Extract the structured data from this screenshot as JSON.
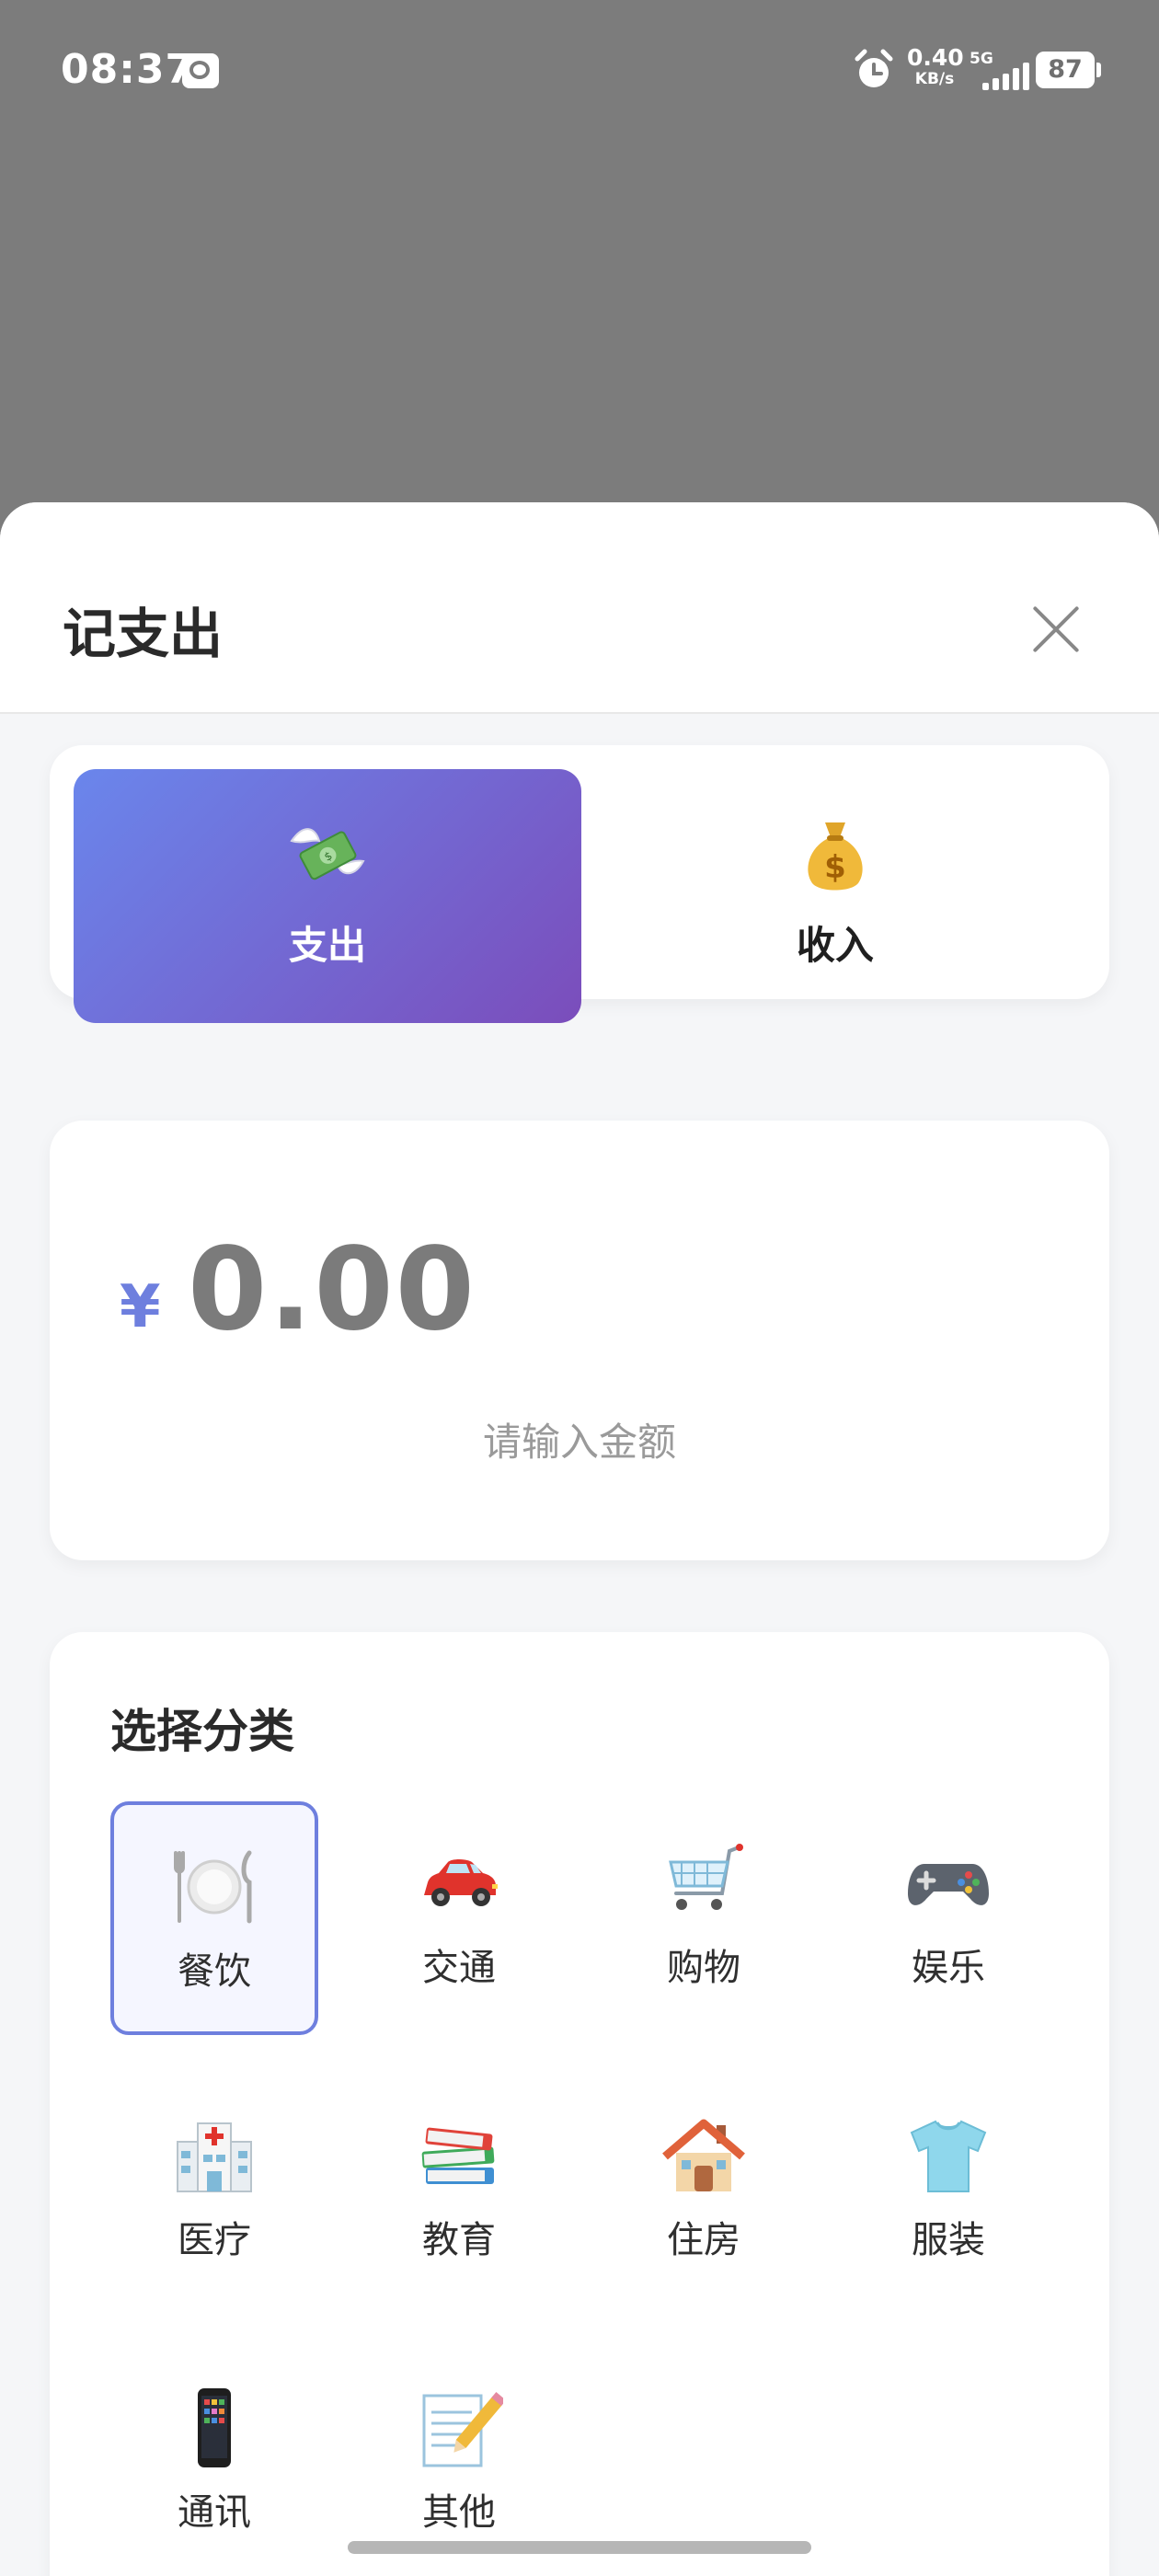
{
  "status_bar": {
    "time": "08:37",
    "net_rate_value": "0.40",
    "net_rate_unit": "KB/s",
    "network": "5G",
    "battery": "87"
  },
  "sheet": {
    "title": "记支出",
    "close_icon": "close-icon"
  },
  "type_tabs": {
    "expense": {
      "label": "支出",
      "icon": "money-with-wings-icon",
      "selected": true
    },
    "income": {
      "label": "收入",
      "icon": "money-bag-icon",
      "selected": false
    }
  },
  "amount": {
    "currency": "¥",
    "value": "0.00",
    "hint": "请输入金额"
  },
  "category": {
    "title": "选择分类",
    "items": [
      {
        "label": "餐饮",
        "icon": "plate-cutlery-icon",
        "selected": true
      },
      {
        "label": "交通",
        "icon": "car-icon",
        "selected": false
      },
      {
        "label": "购物",
        "icon": "shopping-cart-icon",
        "selected": false
      },
      {
        "label": "娱乐",
        "icon": "game-controller-icon",
        "selected": false
      },
      {
        "label": "医疗",
        "icon": "hospital-icon",
        "selected": false
      },
      {
        "label": "教育",
        "icon": "books-icon",
        "selected": false
      },
      {
        "label": "住房",
        "icon": "house-icon",
        "selected": false
      },
      {
        "label": "服装",
        "icon": "t-shirt-icon",
        "selected": false
      },
      {
        "label": "通讯",
        "icon": "mobile-phone-icon",
        "selected": false
      },
      {
        "label": "其他",
        "icon": "memo-icon",
        "selected": false
      }
    ]
  },
  "colors": {
    "accent": "#6e7fde",
    "gradient_start": "#6a86ec",
    "gradient_end": "#7b4dbb",
    "overlay": "#7c7c7c"
  }
}
